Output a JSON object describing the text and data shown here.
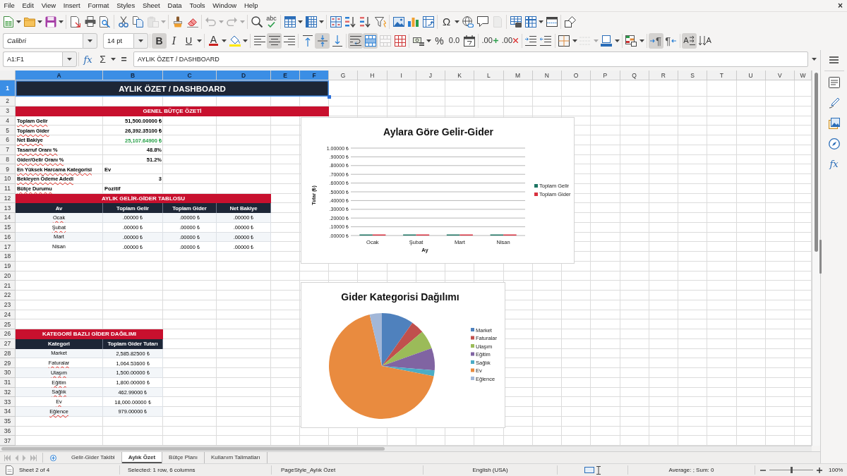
{
  "menu_bar": {
    "items": [
      "File",
      "Edit",
      "View",
      "Insert",
      "Format",
      "Styles",
      "Sheet",
      "Data",
      "Tools",
      "Window",
      "Help"
    ],
    "close": "×"
  },
  "standard_toolbar": {
    "paste_disabled": true,
    "undo_disabled": true,
    "redo_disabled": true,
    "spelling_label": "abc",
    "special_character_label": "Ω",
    "headers_footers_disabled": true
  },
  "formatting_toolbar": {
    "font_name": "Calibri",
    "font_size": "14 pt",
    "bold": {
      "label": "B",
      "pressed": true
    },
    "italic": {
      "label": "I",
      "pressed": false
    },
    "underline": {
      "label": "U",
      "pressed": false
    },
    "font_color_label": "A",
    "horizontal_align": {
      "left": false,
      "center": true,
      "right": false
    },
    "vertical_align": {
      "top": false,
      "center": true,
      "bottom": false
    },
    "wrap_text": true,
    "merge_and_center": true,
    "merge_disabled": true,
    "percent_label": "%",
    "number_label": "0.0",
    "add_decimal_label": ".00",
    "delete_decimal_label": ".00",
    "border_style_disabled": true,
    "left_to_right": {
      "label": "¶",
      "pressed": true
    },
    "right_to_left": {
      "label": "¶",
      "pressed": false
    },
    "text_left_to_right": {
      "label": "A",
      "pressed": true
    },
    "text_top_to_bottom": {
      "label": "A",
      "pressed": false
    }
  },
  "formula_bar": {
    "name_box": "A1:F1",
    "function_wizard": "fx",
    "sum": "Σ",
    "formula": "=",
    "content": "AYLIK ÖZET / DASHBOARD"
  },
  "sidebar": {
    "functions_label": "fx"
  },
  "sheet": {
    "columns": [
      {
        "label": "A",
        "selected": true
      },
      {
        "label": "B",
        "selected": true
      },
      {
        "label": "C",
        "selected": true
      },
      {
        "label": "D",
        "selected": true
      },
      {
        "label": "E",
        "selected": true
      },
      {
        "label": "F",
        "selected": true
      },
      {
        "label": "G",
        "selected": false
      },
      {
        "label": "H",
        "selected": false
      },
      {
        "label": "I",
        "selected": false
      },
      {
        "label": "J",
        "selected": false
      },
      {
        "label": "K",
        "selected": false
      },
      {
        "label": "L",
        "selected": false
      },
      {
        "label": "M",
        "selected": false
      },
      {
        "label": "N",
        "selected": false
      },
      {
        "label": "O",
        "selected": false
      },
      {
        "label": "P",
        "selected": false
      },
      {
        "label": "Q",
        "selected": false
      },
      {
        "label": "R",
        "selected": false
      },
      {
        "label": "S",
        "selected": false
      },
      {
        "label": "T",
        "selected": false
      },
      {
        "label": "U",
        "selected": false
      },
      {
        "label": "V",
        "selected": false
      },
      {
        "label": "W",
        "selected": false
      }
    ],
    "rows": [
      {
        "label": "1",
        "selected": true
      },
      {
        "label": "2",
        "selected": false
      },
      {
        "label": "3",
        "selected": false
      },
      {
        "label": "4",
        "selected": false
      },
      {
        "label": "5",
        "selected": false
      },
      {
        "label": "6",
        "selected": false
      },
      {
        "label": "7",
        "selected": false
      },
      {
        "label": "8",
        "selected": false
      },
      {
        "label": "9",
        "selected": false
      },
      {
        "label": "10",
        "selected": false
      },
      {
        "label": "11",
        "selected": false
      },
      {
        "label": "12",
        "selected": false
      },
      {
        "label": "13",
        "selected": false
      },
      {
        "label": "14",
        "selected": false
      },
      {
        "label": "15",
        "selected": false
      },
      {
        "label": "16",
        "selected": false
      },
      {
        "label": "17",
        "selected": false
      },
      {
        "label": "18",
        "selected": false
      },
      {
        "label": "19",
        "selected": false
      },
      {
        "label": "20",
        "selected": false
      },
      {
        "label": "21",
        "selected": false
      },
      {
        "label": "22",
        "selected": false
      },
      {
        "label": "23",
        "selected": false
      },
      {
        "label": "24",
        "selected": false
      },
      {
        "label": "25",
        "selected": false
      },
      {
        "label": "26",
        "selected": false
      },
      {
        "label": "27",
        "selected": false
      },
      {
        "label": "28",
        "selected": false
      },
      {
        "label": "29",
        "selected": false
      },
      {
        "label": "30",
        "selected": false
      },
      {
        "label": "31",
        "selected": false
      },
      {
        "label": "32",
        "selected": false
      },
      {
        "label": "33",
        "selected": false
      },
      {
        "label": "34",
        "selected": false
      },
      {
        "label": "35",
        "selected": false
      },
      {
        "label": "36",
        "selected": false
      },
      {
        "label": "37",
        "selected": false
      }
    ],
    "title": {
      "text": "AYLIK ÖZET / DASHBOARD",
      "selected": true
    },
    "summary": {
      "heading": "GENEL BÜTÇE ÖZETİ",
      "items": [
        {
          "label": "Toplam Gelir",
          "misspelled": true,
          "value": "51,500.00000 ₺",
          "kind": "number"
        },
        {
          "label": "Toplam Gider",
          "misspelled": true,
          "value": "26,392.35100 ₺",
          "kind": "number"
        },
        {
          "label": "Net Bakiye",
          "misspelled": true,
          "value": "25,107.64900 ₺",
          "kind": "number",
          "color": "#27a048"
        },
        {
          "label": "Tasarruf Oranı %",
          "misspelled": true,
          "value": "48.8%",
          "kind": "number"
        },
        {
          "label": "Gider/Gelir Oranı %",
          "misspelled": true,
          "value": "51.2%",
          "kind": "number"
        },
        {
          "label": "En Yüksek Harcama Kategorisi",
          "misspelled": true,
          "value": "Ev",
          "kind": "text"
        },
        {
          "label": "Bekleyen Ödeme Adedi",
          "misspelled": true,
          "value": "3",
          "kind": "number"
        },
        {
          "label": "Bütçe Durumu",
          "misspelled": true,
          "value": "Pozitif",
          "kind": "text"
        }
      ]
    },
    "monthly_table": {
      "heading": "AYLIK GELİR-GİDER TABLOSU",
      "columns": [
        "Av",
        "Toplam Gelir",
        "Toplam Gider",
        "Net Bakiye"
      ],
      "rows": [
        {
          "month": "Ocak",
          "misspelled": true,
          "income": ".00000 ₺",
          "expense": ".00000 ₺",
          "net": ".00000 ₺"
        },
        {
          "month": "Şubat",
          "misspelled": true,
          "income": ".00000 ₺",
          "expense": ".00000 ₺",
          "net": ".00000 ₺"
        },
        {
          "month": "Mart",
          "misspelled": false,
          "income": ".00000 ₺",
          "expense": ".00000 ₺",
          "net": ".00000 ₺"
        },
        {
          "month": "Nisan",
          "misspelled": false,
          "income": ".00000 ₺",
          "expense": ".00000 ₺",
          "net": ".00000 ₺"
        }
      ]
    },
    "category_table": {
      "heading": "KATEGORİ BAZLI GİDER DAĞILIMI",
      "columns": [
        "Kategori",
        "Toplam Gider Tutarı"
      ],
      "rows": [
        {
          "category": "Market",
          "misspelled": false,
          "amount": "2,585.82500 ₺"
        },
        {
          "category": "Faturalar",
          "misspelled": true,
          "amount": "1,064.53600 ₺"
        },
        {
          "category": "Ulaşım",
          "misspelled": true,
          "amount": "1,500.00000 ₺"
        },
        {
          "category": "Eğitim",
          "misspelled": true,
          "amount": "1,800.00000 ₺"
        },
        {
          "category": "Sağlık",
          "misspelled": true,
          "amount": "462.99000 ₺"
        },
        {
          "category": "Ev",
          "misspelled": true,
          "amount": "18,000.00000 ₺"
        },
        {
          "category": "Eğlence",
          "misspelled": true,
          "amount": "979.00000 ₺"
        }
      ]
    },
    "charts": [
      {
        "chart_data": {
          "type": "bar",
          "title": "Aylara Göre Gelir-Gider",
          "xlabel": "Ay",
          "ylabel": "Tutar (₺)",
          "categories": [
            "Ocak",
            "Şubat",
            "Mart",
            "Nisan"
          ],
          "series": [
            {
              "name": "Toplam Gelir",
              "color": "#1d7563",
              "values": [
                0,
                0,
                0,
                0
              ]
            },
            {
              "name": "Toplam Gider",
              "color": "#d8313f",
              "values": [
                0,
                0,
                0,
                0
              ]
            }
          ],
          "ylim": [
            0,
            1
          ],
          "yticks": [
            {
              "value": 0,
              "label": ".00000 ₺"
            },
            {
              "value": 0.1,
              "label": ".10000 ₺"
            },
            {
              "value": 0.2,
              "label": ".20000 ₺"
            },
            {
              "value": 0.3,
              "label": ".30000 ₺"
            },
            {
              "value": 0.4,
              "label": ".40000 ₺"
            },
            {
              "value": 0.5,
              "label": ".50000 ₺"
            },
            {
              "value": 0.6,
              "label": ".60000 ₺"
            },
            {
              "value": 0.7,
              "label": ".70000 ₺"
            },
            {
              "value": 0.8,
              "label": ".80000 ₺"
            },
            {
              "value": 0.9,
              "label": ".90000 ₺"
            },
            {
              "value": 1,
              "label": "1.00000 ₺"
            }
          ],
          "grid": true,
          "legend": "right"
        }
      },
      {
        "chart_data": {
          "type": "pie",
          "title": "Gider Kategorisi Dağılımı",
          "categories": [
            "Market",
            "Faturalar",
            "Ulaşım",
            "Eğitim",
            "Sağlık",
            "Ev",
            "Eğlence"
          ],
          "values": [
            9.798,
            4.034,
            5.683,
            6.82,
            1.754,
            68.202,
            3.709
          ],
          "colors": [
            "#4f81bd",
            "#c0504d",
            "#9bbb59",
            "#8064a2",
            "#4bacc6",
            "#e98b3f",
            "#a2b7d8"
          ],
          "legend": "right"
        }
      }
    ]
  },
  "sheet_tabs": [
    {
      "label": "Gelir-Gider Takibi",
      "selected": false
    },
    {
      "label": "Aylık Özet",
      "selected": true
    },
    {
      "label": "Bütçe Planı",
      "selected": false
    },
    {
      "label": "Kullanım Talimatları",
      "selected": false
    }
  ],
  "status_bar": {
    "sheet": "Sheet 2 of 4",
    "selection": "Selected: 1 row, 6 columns",
    "page_style": "PageStyle_Aylık Özet",
    "language": "English (USA)",
    "summary": "Average: ; Sum: 0",
    "zoom": {
      "label": "100%",
      "level": 0.5
    }
  }
}
